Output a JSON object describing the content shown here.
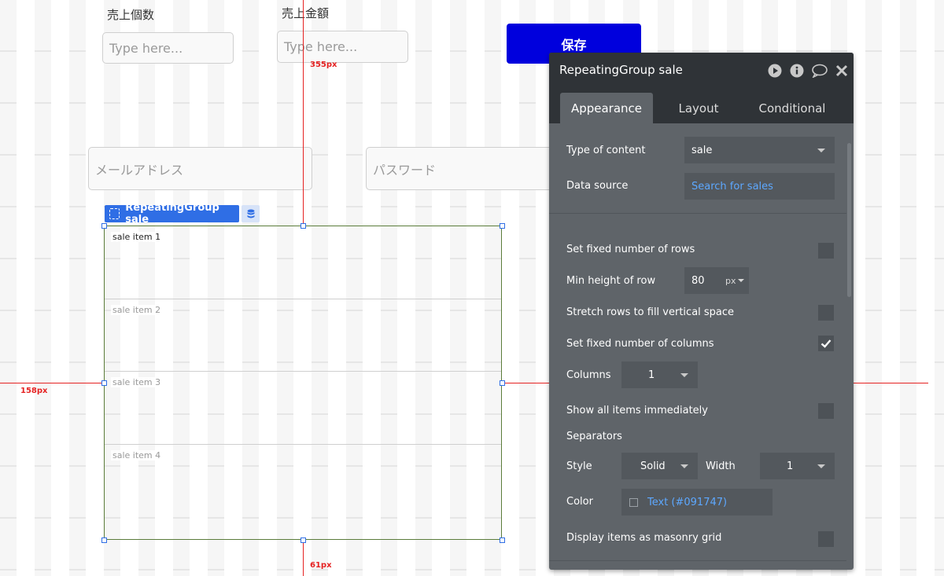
{
  "form": {
    "qty_label": "売上個数",
    "amount_label": "売上金額",
    "qty_placeholder": "Type here...",
    "amount_placeholder": "Type here...",
    "email_placeholder": "メールアドレス",
    "password_placeholder": "パスワード",
    "save_label": "保存",
    "save_color": "#0000DD"
  },
  "guides": {
    "top_distance": "355px",
    "left_distance": "158px",
    "bottom_distance": "61px",
    "color": "#E52222"
  },
  "repeating_group": {
    "tag_label": "RepeatingGroup sale",
    "rows": [
      "sale item 1",
      "sale item 2",
      "sale item 3",
      "sale item 4"
    ]
  },
  "panel": {
    "title": "RepeatingGroup sale",
    "icons": [
      "play-icon",
      "info-icon",
      "comment-icon",
      "close-icon"
    ],
    "tabs": [
      "Appearance",
      "Layout",
      "Conditional"
    ],
    "active_tab": "Appearance",
    "type_of_content_label": "Type of content",
    "type_of_content_value": "sale",
    "data_source_label": "Data source",
    "data_source_value": "Search for sales",
    "fixed_rows_label": "Set fixed number of rows",
    "fixed_rows_checked": false,
    "min_height_label": "Min height of row",
    "min_height_value": "80",
    "min_height_unit": "px",
    "stretch_rows_label": "Stretch rows to fill vertical space",
    "stretch_rows_checked": false,
    "fixed_columns_label": "Set fixed number of columns",
    "fixed_columns_checked": true,
    "columns_label": "Columns",
    "columns_value": "1",
    "show_all_label": "Show all items immediately",
    "show_all_checked": false,
    "separators_label": "Separators",
    "style_label": "Style",
    "style_value": "Solid",
    "width_label": "Width",
    "width_value": "1",
    "color_label": "Color",
    "color_value": "Text (#091747)",
    "link_color": "#5DA8FF",
    "masonry_label": "Display items as masonry grid",
    "masonry_checked": false
  }
}
